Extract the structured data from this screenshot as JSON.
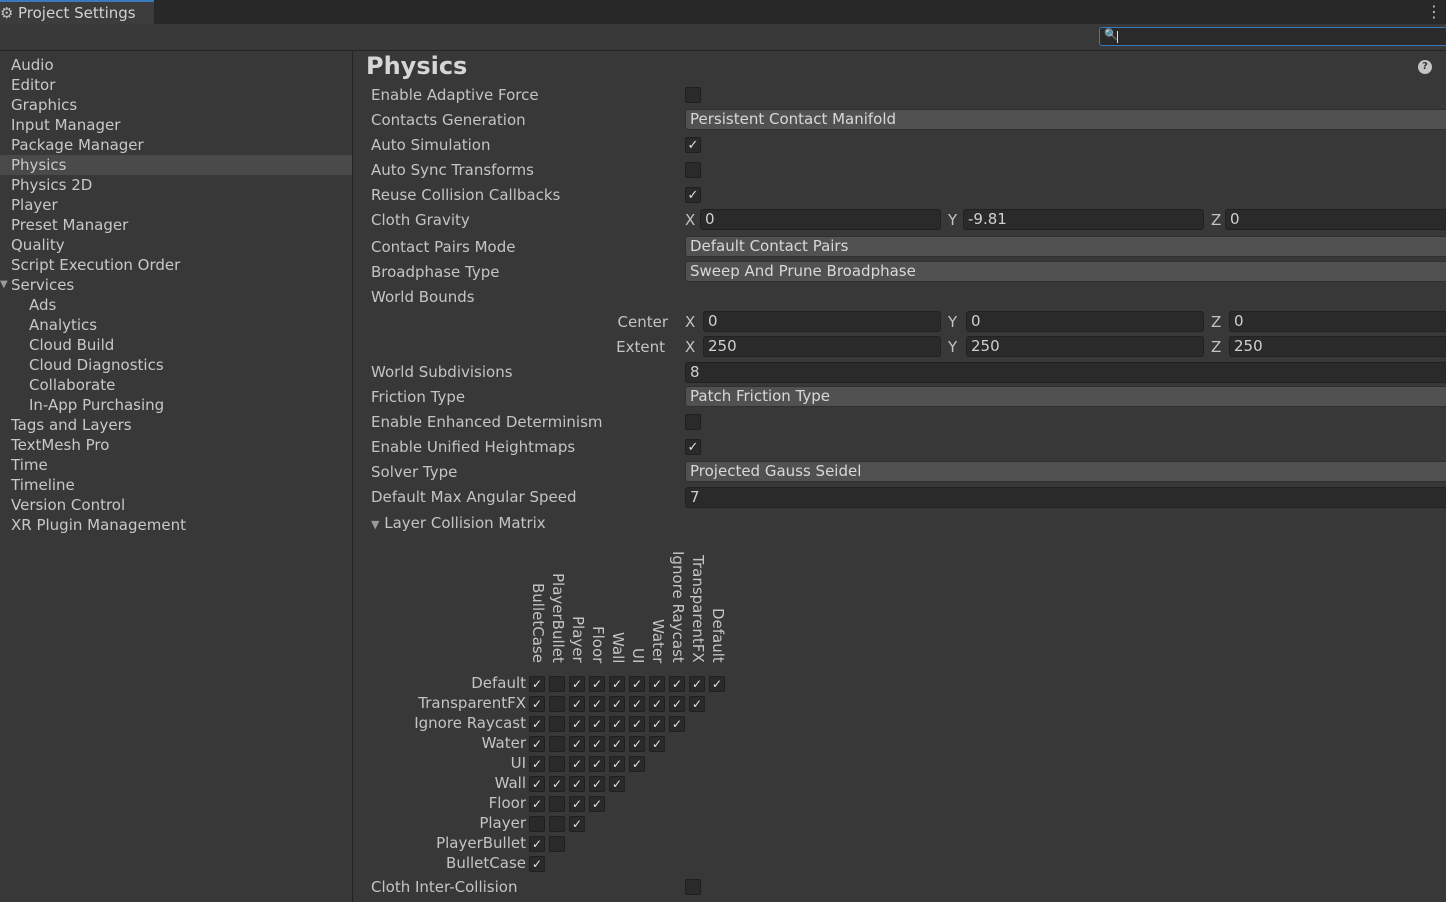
{
  "window": {
    "tab_title": "Project Settings",
    "tab_icon": "gear-icon",
    "menu_icon": "⋮",
    "search": {
      "value": "",
      "placeholder": ""
    }
  },
  "sidebar": {
    "items": [
      {
        "label": "Audio"
      },
      {
        "label": "Editor"
      },
      {
        "label": "Graphics"
      },
      {
        "label": "Input Manager"
      },
      {
        "label": "Package Manager"
      },
      {
        "label": "Physics",
        "selected": true
      },
      {
        "label": "Physics 2D"
      },
      {
        "label": "Player"
      },
      {
        "label": "Preset Manager"
      },
      {
        "label": "Quality"
      },
      {
        "label": "Script Execution Order"
      },
      {
        "label": "Services",
        "expanded": true
      },
      {
        "label": "Ads",
        "child": true
      },
      {
        "label": "Analytics",
        "child": true
      },
      {
        "label": "Cloud Build",
        "child": true
      },
      {
        "label": "Cloud Diagnostics",
        "child": true
      },
      {
        "label": "Collaborate",
        "child": true
      },
      {
        "label": "In-App Purchasing",
        "child": true
      },
      {
        "label": "Tags and Layers"
      },
      {
        "label": "TextMesh Pro"
      },
      {
        "label": "Time"
      },
      {
        "label": "Timeline"
      },
      {
        "label": "Version Control"
      },
      {
        "label": "XR Plugin Management"
      }
    ]
  },
  "main": {
    "title": "Physics",
    "help_icon": "?",
    "settings": {
      "enable_adaptive_force": {
        "label": "Enable Adaptive Force",
        "checked": false
      },
      "contacts_generation": {
        "label": "Contacts Generation",
        "value": "Persistent Contact Manifold"
      },
      "auto_simulation": {
        "label": "Auto Simulation",
        "checked": true
      },
      "auto_sync_transforms": {
        "label": "Auto Sync Transforms",
        "checked": false
      },
      "reuse_collision_callbacks": {
        "label": "Reuse Collision Callbacks",
        "checked": true
      },
      "cloth_gravity": {
        "label": "Cloth Gravity",
        "x": "0",
        "y": "-9.81",
        "z": "0"
      },
      "contact_pairs_mode": {
        "label": "Contact Pairs Mode",
        "value": "Default Contact Pairs"
      },
      "broadphase_type": {
        "label": "Broadphase Type",
        "value": "Sweep And Prune Broadphase"
      },
      "world_bounds": {
        "label": "World Bounds",
        "center": {
          "label": "Center",
          "x": "0",
          "y": "0",
          "z": "0"
        },
        "extent": {
          "label": "Extent",
          "x": "250",
          "y": "250",
          "z": "250"
        }
      },
      "world_subdivisions": {
        "label": "World Subdivisions",
        "value": "8"
      },
      "friction_type": {
        "label": "Friction Type",
        "value": "Patch Friction Type"
      },
      "enable_enhanced_determinism": {
        "label": "Enable Enhanced Determinism",
        "checked": false
      },
      "enable_unified_heightmaps": {
        "label": "Enable Unified Heightmaps",
        "checked": true
      },
      "solver_type": {
        "label": "Solver Type",
        "value": "Projected Gauss Seidel"
      },
      "default_max_angular_speed": {
        "label": "Default Max Angular Speed",
        "value": "7"
      },
      "cloth_inter_collision": {
        "label": "Cloth Inter-Collision",
        "checked": false
      }
    },
    "axis_labels": {
      "x": "X",
      "y": "Y",
      "z": "Z"
    },
    "layer_matrix": {
      "label": "Layer Collision Matrix",
      "columns": [
        "BulletCase",
        "PlayerBullet",
        "Player",
        "Floor",
        "Wall",
        "UI",
        "Water",
        "Ignore Raycast",
        "TransparentFX",
        "Default"
      ],
      "rows": [
        "Default",
        "TransparentFX",
        "Ignore Raycast",
        "Water",
        "UI",
        "Wall",
        "Floor",
        "Player",
        "PlayerBullet",
        "BulletCase"
      ],
      "cells": [
        [
          true,
          false,
          true,
          true,
          true,
          true,
          true,
          true,
          true,
          true
        ],
        [
          true,
          false,
          true,
          true,
          true,
          true,
          true,
          true,
          true
        ],
        [
          true,
          false,
          true,
          true,
          true,
          true,
          true,
          true
        ],
        [
          true,
          false,
          true,
          true,
          true,
          true,
          true
        ],
        [
          true,
          false,
          true,
          true,
          true,
          true
        ],
        [
          true,
          true,
          true,
          true,
          true
        ],
        [
          true,
          false,
          true,
          true
        ],
        [
          false,
          false,
          true
        ],
        [
          true,
          false
        ],
        [
          true
        ]
      ]
    }
  }
}
